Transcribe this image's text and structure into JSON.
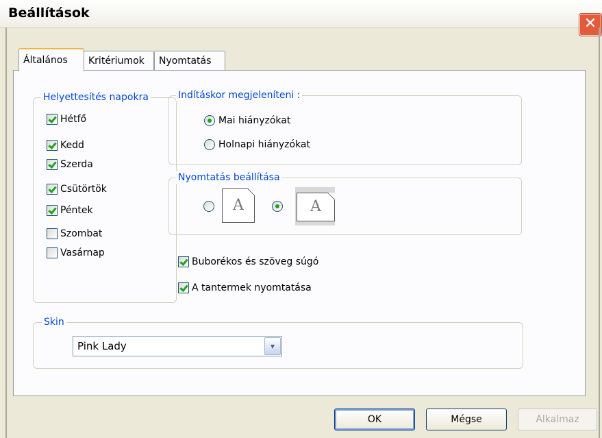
{
  "window": {
    "title": "Beállítások",
    "close_glyph": "✕"
  },
  "tabs": [
    {
      "label": "Általános",
      "active": true
    },
    {
      "label": "Kritériumok",
      "active": false
    },
    {
      "label": "Nyomtatás",
      "active": false
    }
  ],
  "days_group": {
    "label": "Helyettesítés napokra",
    "items": [
      {
        "label": "Hétfő",
        "checked": true
      },
      {
        "label": "Kedd",
        "checked": true
      },
      {
        "label": "Szerda",
        "checked": true
      },
      {
        "label": "Csütörtök",
        "checked": true
      },
      {
        "label": "Péntek",
        "checked": true
      },
      {
        "label": "Szombat",
        "checked": false
      },
      {
        "label": "Vasárnap",
        "checked": false
      }
    ]
  },
  "startup_group": {
    "label": "Indításkor megjeleníteni :",
    "options": [
      {
        "label": "Mai hiányzókat",
        "selected": true
      },
      {
        "label": "Holnapi hiányzókat",
        "selected": false
      }
    ]
  },
  "print_group": {
    "label": "Nyomtatás beállítása",
    "portrait": {
      "glyph": "A",
      "selected": false
    },
    "landscape": {
      "glyph": "A",
      "selected": true
    }
  },
  "options": [
    {
      "label": "Buborékos és szöveg súgó",
      "checked": true
    },
    {
      "label": "A tantermek nyomtatása",
      "checked": true
    }
  ],
  "skin_group": {
    "label": "Skin",
    "selected": "Pink Lady",
    "arrow_glyph": "▾"
  },
  "buttons": {
    "ok": "OK",
    "cancel": "Mégse",
    "apply": "Alkalmaz"
  }
}
